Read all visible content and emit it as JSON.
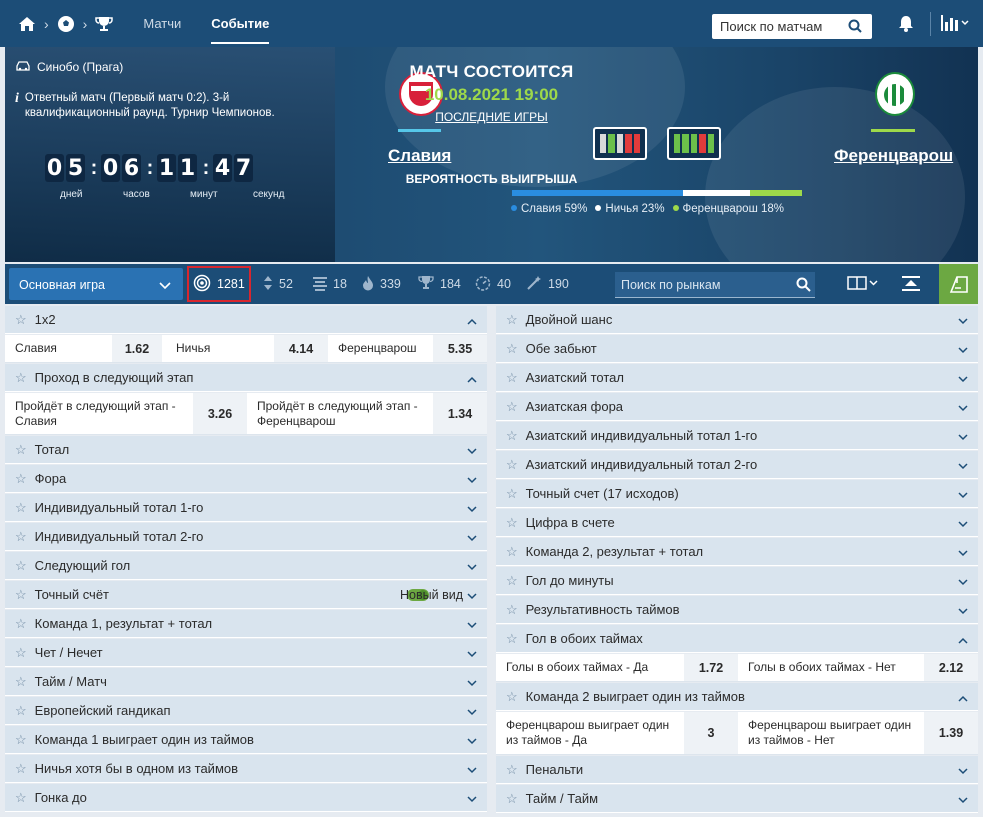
{
  "nav": {
    "tabs": [
      "Матчи",
      "Событие"
    ],
    "search_label": "Поиск по матчам"
  },
  "match": {
    "venue": "Синобо (Прага)",
    "info": "Ответный матч (Первый матч 0:2). 3-й квалификационный раунд. Турнир Чемпионов.",
    "countdown": {
      "digits": [
        "0",
        "5",
        "0",
        "6",
        "1",
        "1",
        "4",
        "7"
      ],
      "labels": [
        "дней",
        "часов",
        "минут",
        "секунд"
      ]
    },
    "title": "МАТЧ СОСТОИТСЯ",
    "datetime": "10.08.2021 19:00",
    "last_games": "ПОСЛЕДНИЕ ИГРЫ",
    "team1": "Славия",
    "team2": "Ференцварош",
    "team1_form": [
      "w",
      "l",
      "w",
      "l",
      "l"
    ],
    "team2_form": [
      "w",
      "w",
      "w",
      "l",
      "w"
    ],
    "prob_title": "ВЕРОЯТНОСТЬ ВЫИГРЫША",
    "probabilities": [
      {
        "label": "Славия 59%",
        "value": 59,
        "color": "#2a8de0"
      },
      {
        "label": "Ничья 23%",
        "value": 23,
        "color": "#ffffff"
      },
      {
        "label": "Ференцварош 18%",
        "value": 18,
        "color": "#9ed94a"
      }
    ]
  },
  "markets_bar": {
    "select": "Основная игра",
    "counts": [
      {
        "icon": "target-icon",
        "value": "1281"
      },
      {
        "icon": "updown-icon",
        "value": "52"
      },
      {
        "icon": "bars-icon",
        "value": "18"
      },
      {
        "icon": "fire-icon",
        "value": "339"
      },
      {
        "icon": "trophy-icon",
        "value": "184"
      },
      {
        "icon": "timer-icon",
        "value": "40"
      },
      {
        "icon": "wand-icon",
        "value": "190"
      }
    ],
    "search_placeholder": "Поиск по рынкам"
  },
  "left": {
    "m1x2": {
      "title": "1х2",
      "rows": [
        {
          "a": "Славия",
          "av": "1.62",
          "b": "Ничья",
          "bv": "4.14",
          "c": "Ференцварош",
          "cv": "5.35"
        }
      ]
    },
    "pass": {
      "title": "Проход в следующий этап",
      "a": "Пройдёт в следующий этап - Славия",
      "av": "3.26",
      "b": "Пройдёт в следующий этап - Ференцварош",
      "bv": "1.34"
    },
    "collapsed": [
      "Тотал",
      "Фора",
      "Индивидуальный тотал 1-го",
      "Индивидуальный тотал 2-го",
      "Следующий гол",
      "Точный счёт",
      "Команда 1, результат + тотал",
      "Чет / Нечет",
      "Тайм / Матч",
      "Европейский гандикап",
      "Команда 1 выиграет один из таймов",
      "Ничья хотя бы в одном из таймов",
      "Гонка до"
    ],
    "new_view": "Новый вид"
  },
  "right": {
    "collapsed_top": [
      "Двойной шанс",
      "Обе забьют",
      "Азиатский тотал",
      "Азиатская фора",
      "Азиатский индивидуальный тотал 1-го",
      "Азиатский индивидуальный тотал 2-го",
      "Точный счет (17 исходов)",
      "Цифра в счете",
      "Команда 2, результат + тотал",
      "Гол до минуты",
      "Результативность таймов"
    ],
    "both": {
      "title": "Гол в обоих таймах",
      "a": "Голы в обоих таймах - Да",
      "av": "1.72",
      "b": "Голы в обоих таймах - Нет",
      "bv": "2.12"
    },
    "team2half": {
      "title": "Команда 2 выиграет один из таймов",
      "a": "Ференцварош выиграет один из таймов - Да",
      "av": "3",
      "b": "Ференцварош выиграет один из таймов - Нет",
      "bv": "1.39"
    },
    "collapsed_bottom": [
      "Пенальти",
      "Тайм / Тайм"
    ]
  }
}
